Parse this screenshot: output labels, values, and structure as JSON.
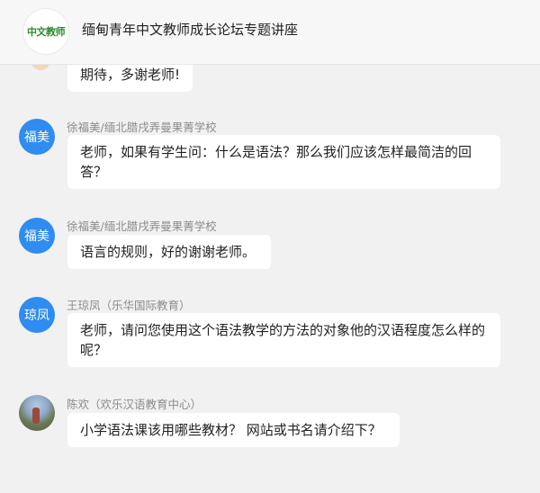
{
  "header": {
    "logo_text": "中文教师",
    "title": "缅甸青年中文教师成长论坛专题讲座"
  },
  "messages": [
    {
      "sender": "",
      "avatar_text": "",
      "text": "期待，多谢老师!"
    },
    {
      "sender": "徐福美/缅北腊戌弄曼果菁学校",
      "avatar_text": "福美",
      "text": "老师，如果有学生问：什么是语法？那么我们应该怎样最简洁的回答？"
    },
    {
      "sender": "徐福美/缅北腊戌弄曼果菁学校",
      "avatar_text": "福美",
      "text": "语言的规则，好的谢谢老师。"
    },
    {
      "sender": "王琼凤（乐华国际教育）",
      "avatar_text": "琼凤",
      "text": "老师，请问您使用这个语法教学的方法的对象他的汉语程度怎么样的呢？"
    },
    {
      "sender": "陈欢（欢乐汉语教育中心）",
      "avatar_text": "",
      "text": "小学语法课该用哪些教材？ 网站或书名请介绍下？"
    }
  ],
  "colors": {
    "avatar_blue": "#2f8cf0",
    "bubble_bg": "#ffffff",
    "page_bg": "#f1f1f1",
    "logo_green": "#2e8b2e"
  }
}
